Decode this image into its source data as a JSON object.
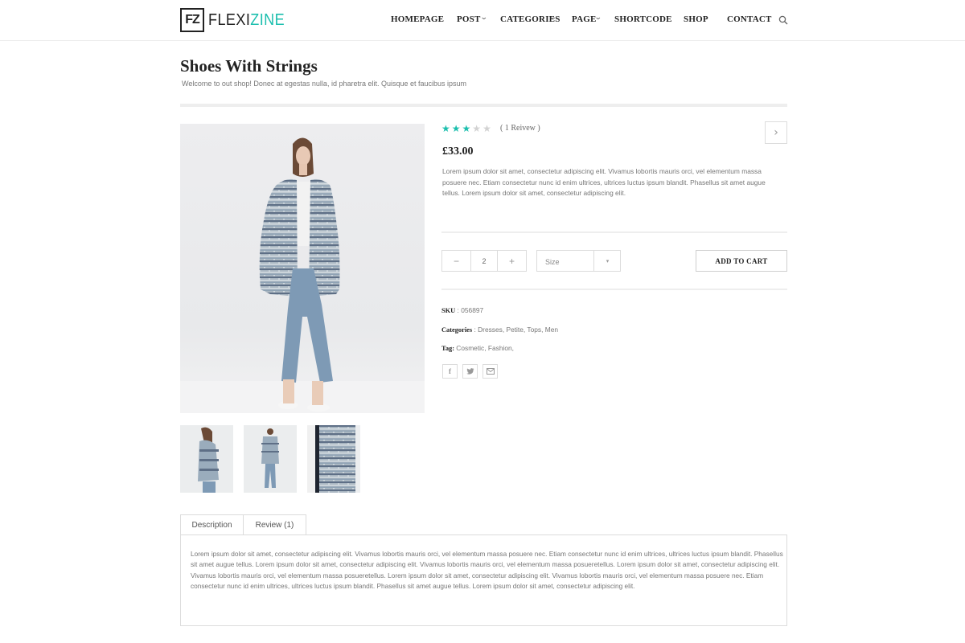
{
  "brand": {
    "logo_mark": "FZ",
    "name_part1": "FLEXI",
    "name_part2": "ZINE",
    "accent_color": "#1cbfae"
  },
  "nav": {
    "items": [
      {
        "label": "HOMEPAGE",
        "has_dropdown": false
      },
      {
        "label": "POST",
        "has_dropdown": true
      },
      {
        "label": "CATEGORIES",
        "has_dropdown": true
      },
      {
        "label": "PAGE",
        "has_dropdown": true
      },
      {
        "label": "SHORTCODE",
        "has_dropdown": false
      },
      {
        "label": "SHOP",
        "has_dropdown": false
      },
      {
        "label": "CONTACT",
        "has_dropdown": false
      }
    ],
    "search_icon": "search-icon"
  },
  "page": {
    "title": "Shoes With Strings",
    "subtitle": "Welcome to out shop! Donec at egestas nulla, id pharetra elit. Quisque et faucibus ipsum"
  },
  "product": {
    "rating": 3,
    "rating_max": 5,
    "review_count_text": "( 1 Reivew )",
    "price": "£33.00",
    "short_description": "Lorem ipsum dolor sit amet, consectetur adipiscing elit. Vivamus lobortis mauris orci, vel elementum massa posuere nec. Etiam consectetur nunc id enim ultrices, ultrices luctus ipsum blandit. Phasellus sit amet augue tellus. Lorem ipsum dolor sit amet, consectetur adipiscing elit.",
    "quantity": {
      "minus": "−",
      "value": "2",
      "plus": "+"
    },
    "size_select": {
      "selected": "Size"
    },
    "add_to_cart_label": "ADD TO CART",
    "sku_label": "SKU",
    "sku_value": " : 056897",
    "categories_label": "Categories",
    "categories_value": " : Dresses, Petite, Tops, Men",
    "tag_label": "Tag:",
    "tag_value": " Cosmetic, Fashion,",
    "share_icons": [
      "facebook-icon",
      "twitter-icon",
      "email-icon"
    ],
    "thumbnails": [
      "thumbnail-side",
      "thumbnail-full",
      "thumbnail-closeup"
    ]
  },
  "tabs": {
    "items": [
      {
        "label": "Description",
        "active": true
      },
      {
        "label": "Review (1)",
        "active": false
      }
    ],
    "description_text": "Lorem ipsum dolor sit amet, consectetur adipiscing elit. Vivamus lobortis mauris orci, vel elementum massa posuere nec. Etiam consectetur nunc id enim ultrices, ultrices luctus ipsum blandit. Phasellus sit amet augue tellus. Lorem ipsum dolor sit amet, consectetur adipiscing elit. Vivamus lobortis mauris orci, vel elementum massa posueretellus. Lorem ipsum dolor sit amet, consectetur adipiscing elit. Vivamus lobortis mauris orci, vel elementum massa posueretellus. Lorem ipsum dolor sit amet, consectetur adipiscing elit. Vivamus lobortis mauris orci, vel elementum massa posuere nec. Etiam consectetur nunc id enim ultrices, ultrices luctus ipsum blandit. Phasellus sit amet augue tellus. Lorem ipsum dolor sit amet, consectetur adipiscing elit."
  }
}
